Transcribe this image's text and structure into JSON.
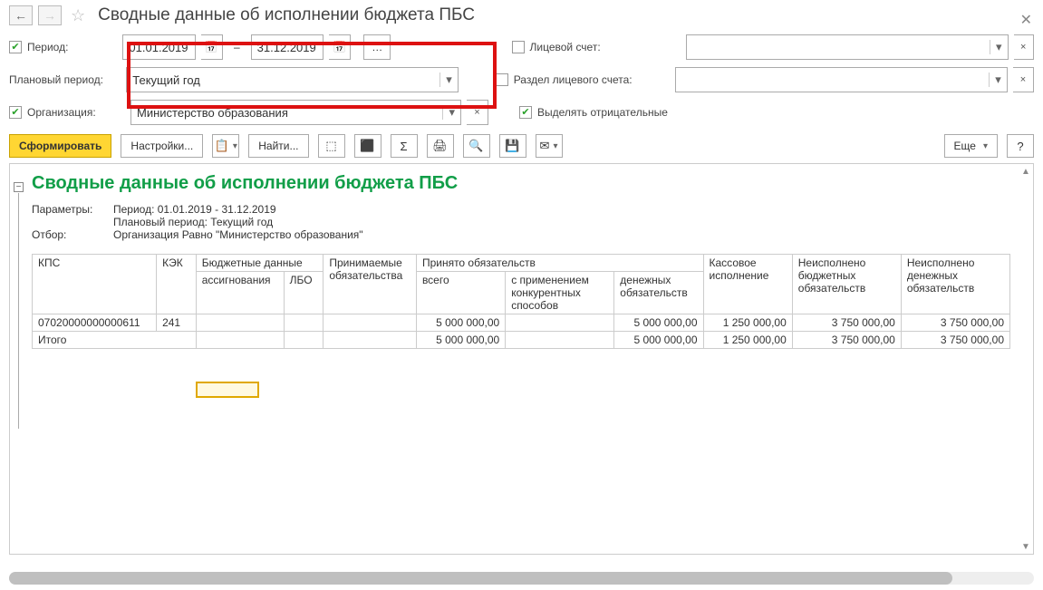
{
  "header": {
    "title": "Сводные данные об исполнении бюджета ПБС"
  },
  "filters": {
    "period_label": "Период:",
    "period_checked": true,
    "date_from": "01.01.2019",
    "date_to": "31.12.2019",
    "plan_period_label": "Плановый период:",
    "plan_period_value": "Текущий год",
    "organization_label": "Организация:",
    "organization_checked": true,
    "organization_value": "Министерство образования",
    "account_label": "Лицевой счет:",
    "account_checked": false,
    "account_value": "",
    "section_label": "Раздел лицевого счета:",
    "section_checked": false,
    "section_value": "",
    "highlight_neg_label": "Выделять отрицательные",
    "highlight_neg_checked": true
  },
  "toolbar": {
    "run": "Сформировать",
    "settings": "Настройки...",
    "find": "Найти...",
    "more": "Еще",
    "help": "?"
  },
  "report": {
    "title": "Сводные данные об исполнении бюджета ПБС",
    "params_label": "Параметры:",
    "params_line1": "Период: 01.01.2019 - 31.12.2019",
    "params_line2": "Плановый период: Текущий год",
    "filter_label": "Отбор:",
    "filter_line": "Организация Равно \"Министерство образования\"",
    "columns": {
      "kps": "КПС",
      "kek": "КЭК",
      "budget_data": "Бюджетные данные",
      "assign": "ассигнования",
      "lbo": "ЛБО",
      "accepted_oblig": "Принимаемые обязательства",
      "taken_oblig": "Принято обязательств",
      "total": "всего",
      "competitive": "с применением конкурентных способов",
      "money_oblig": "денежных обязательств",
      "cash_exec": "Кассовое исполнение",
      "unexec_budget": "Неисполнено бюджетных обязательств",
      "unexec_money": "Неисполнено денежных обязательств"
    },
    "rows": [
      {
        "kps": "07020000000000611",
        "kek": "241",
        "total": "5 000 000,00",
        "money_oblig": "5 000 000,00",
        "cash_exec": "1 250 000,00",
        "unexec_budget": "3 750 000,00",
        "unexec_money": "3 750 000,00"
      }
    ],
    "totals": {
      "label": "Итого",
      "total": "5 000 000,00",
      "money_oblig": "5 000 000,00",
      "cash_exec": "1 250 000,00",
      "unexec_budget": "3 750 000,00",
      "unexec_money": "3 750 000,00"
    }
  }
}
